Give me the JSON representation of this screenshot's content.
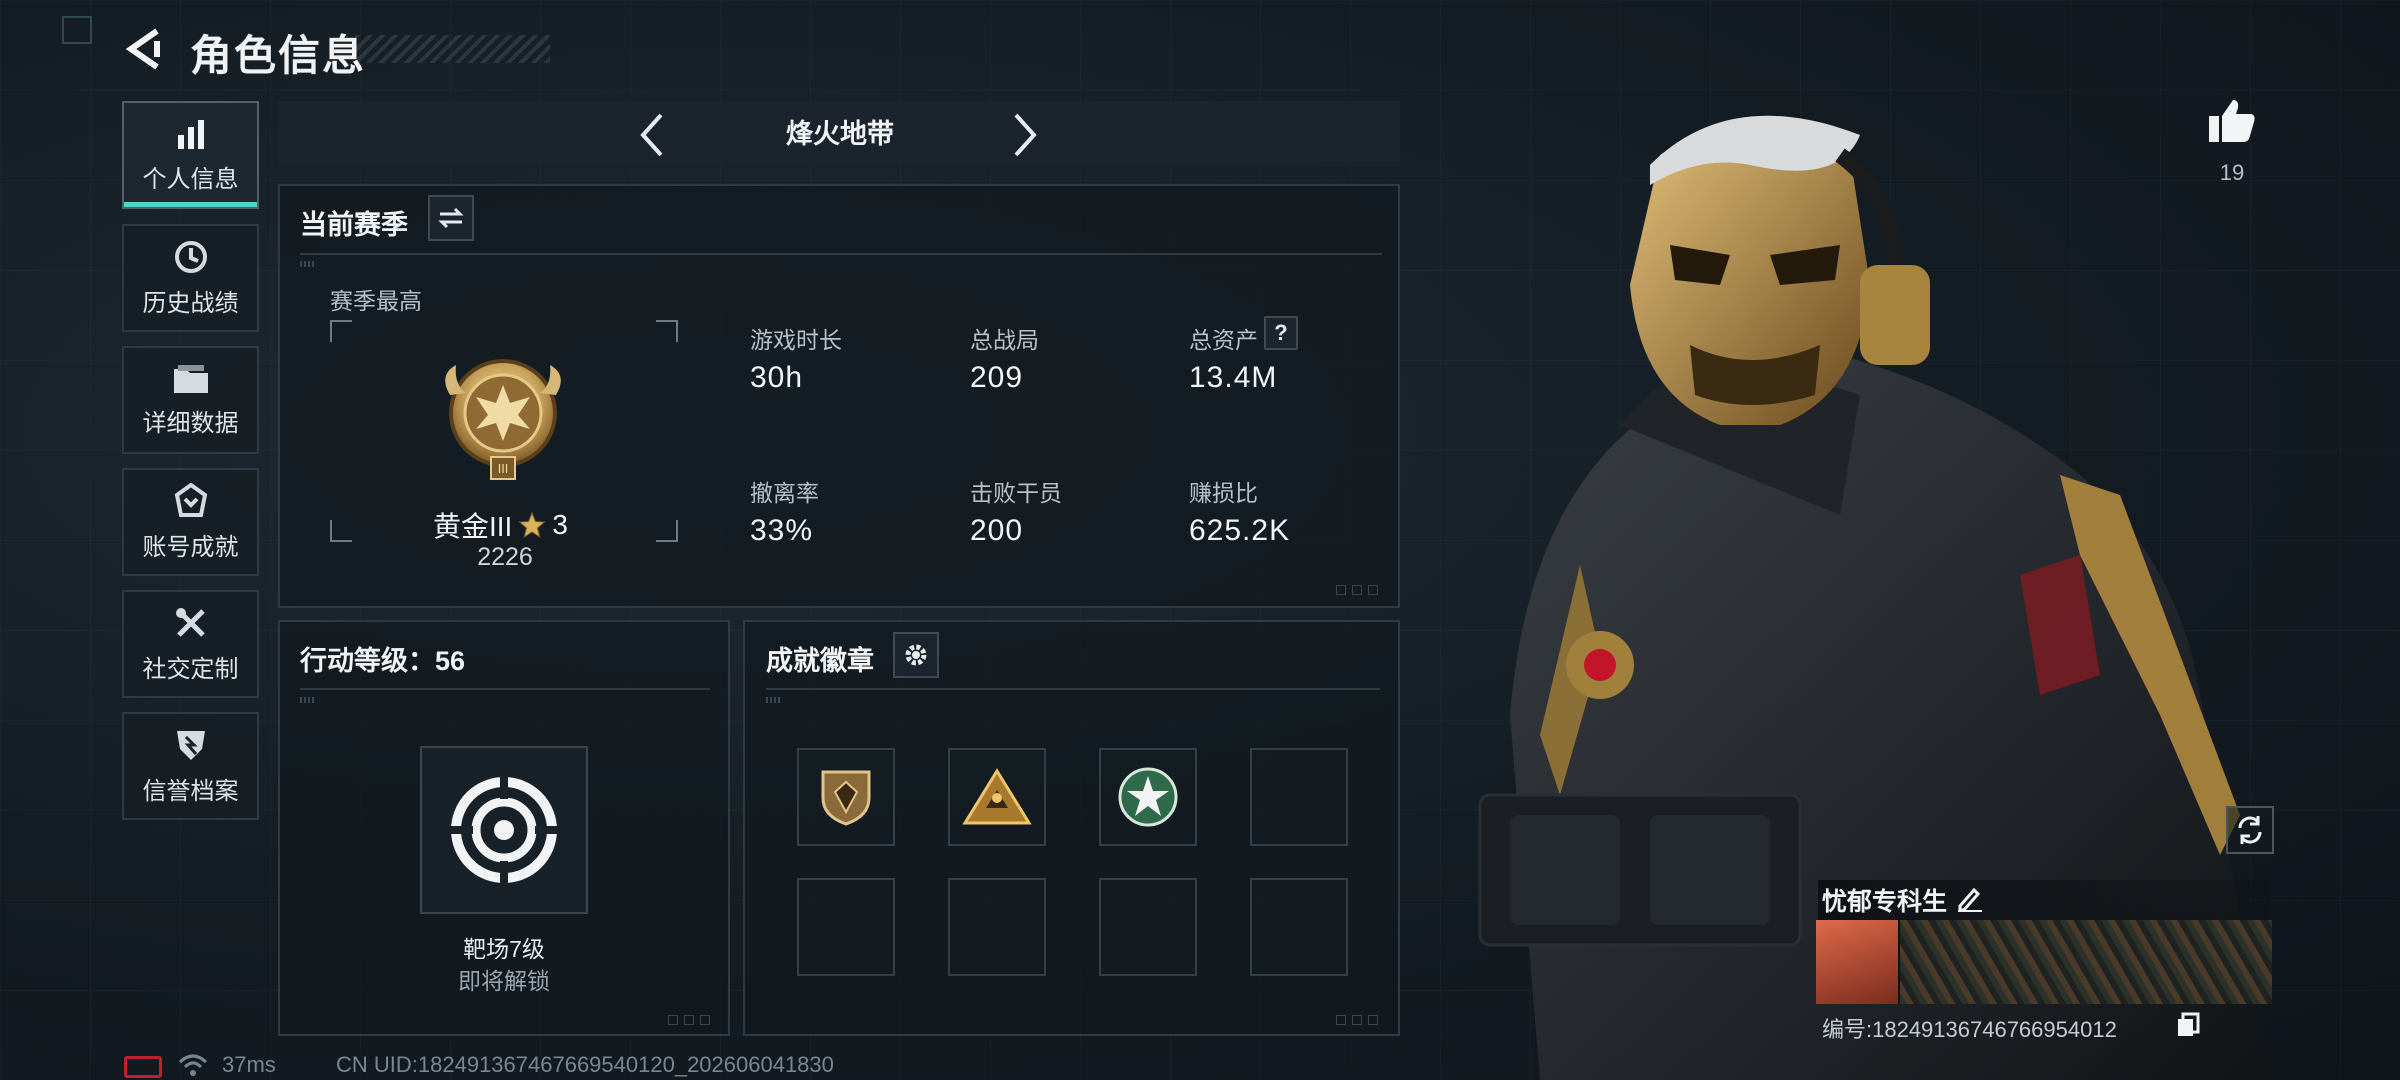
{
  "header": {
    "title": "角色信息"
  },
  "sidebar": {
    "items": [
      {
        "label": "个人信息",
        "icon": "bar-chart-icon",
        "active": true
      },
      {
        "label": "历史战绩",
        "icon": "history-icon"
      },
      {
        "label": "详细数据",
        "icon": "folder-icon"
      },
      {
        "label": "账号成就",
        "icon": "achievement-icon"
      },
      {
        "label": "社交定制",
        "icon": "tools-icon"
      },
      {
        "label": "信誉档案",
        "icon": "shield-icon"
      }
    ]
  },
  "mode": {
    "title": "烽火地带"
  },
  "season": {
    "title": "当前赛季",
    "best_label": "赛季最高",
    "rank_name": "黄金III",
    "rank_stars": "3",
    "rank_score": "2226",
    "stats": [
      {
        "label": "游戏时长",
        "value": "30h"
      },
      {
        "label": "总战局",
        "value": "209"
      },
      {
        "label": "总资产",
        "value": "13.4M"
      },
      {
        "label": "撤离率",
        "value": "33%"
      },
      {
        "label": "击败干员",
        "value": "200"
      },
      {
        "label": "赚损比",
        "value": "625.2K"
      }
    ]
  },
  "action_level": {
    "title": "行动等级：56",
    "unlock_name": "靶场7级",
    "unlock_status": "即将解锁"
  },
  "badges": {
    "title": "成就徽章"
  },
  "like": {
    "count": "19"
  },
  "player": {
    "name": "忧郁专科生",
    "id_line": "编号:18249136746766954012"
  },
  "status": {
    "ping": "37ms",
    "uid": "CN UID:182491367467669540120_202606041830"
  },
  "colors": {
    "accent": "#4fd6c8",
    "gold": "#c8a25a",
    "text": "#e7ebee"
  }
}
